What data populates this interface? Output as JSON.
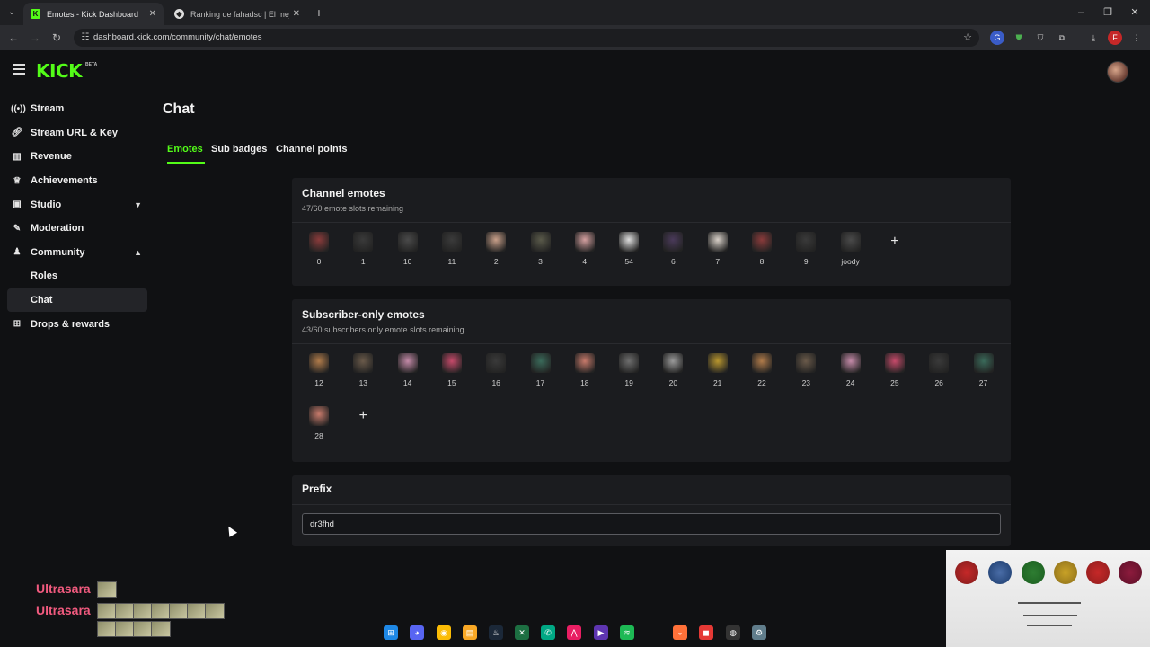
{
  "browser": {
    "tabs": [
      {
        "title": "Emotes - Kick Dashboard",
        "active": true
      },
      {
        "title": "Ranking de fahadsc | El mejor s",
        "active": false
      }
    ],
    "url": "dashboard.kick.com/community/chat/emotes"
  },
  "app": {
    "logo": "KICK",
    "logo_badge": "BETA"
  },
  "sidebar": {
    "items": [
      {
        "label": "Stream",
        "icon": "broadcast-icon"
      },
      {
        "label": "Stream URL & Key",
        "icon": "link-icon"
      },
      {
        "label": "Revenue",
        "icon": "chart-icon"
      },
      {
        "label": "Achievements",
        "icon": "trophy-icon"
      },
      {
        "label": "Studio",
        "icon": "studio-icon"
      },
      {
        "label": "Moderation",
        "icon": "wrench-icon"
      },
      {
        "label": "Community",
        "icon": "community-icon"
      },
      {
        "label": "Roles"
      },
      {
        "label": "Chat"
      },
      {
        "label": "Drops & rewards",
        "icon": "gift-icon"
      }
    ]
  },
  "page": {
    "title": "Chat",
    "tabs": [
      "Emotes",
      "Sub badges",
      "Channel points"
    ]
  },
  "channel_emotes": {
    "title": "Channel emotes",
    "subtitle": "47/60 emote slots remaining",
    "emotes": [
      "0",
      "1",
      "10",
      "11",
      "2",
      "3",
      "4",
      "54",
      "6",
      "7",
      "8",
      "9",
      "joody"
    ]
  },
  "subscriber_emotes": {
    "title": "Subscriber-only emotes",
    "subtitle": "43/60 subscribers only emote slots remaining",
    "emotes": [
      "12",
      "13",
      "14",
      "15",
      "16",
      "17",
      "18",
      "19",
      "20",
      "21",
      "22",
      "23",
      "24",
      "25",
      "26",
      "27",
      "28"
    ]
  },
  "prefix": {
    "title": "Prefix",
    "value": "dr3fhd"
  },
  "overlay": {
    "chat_lines": [
      {
        "user": "Ultrasara"
      },
      {
        "user": "Ultrasara"
      }
    ]
  },
  "colors": {
    "accent": "#53fc18",
    "background": "#101113",
    "card": "#1b1c1f"
  }
}
